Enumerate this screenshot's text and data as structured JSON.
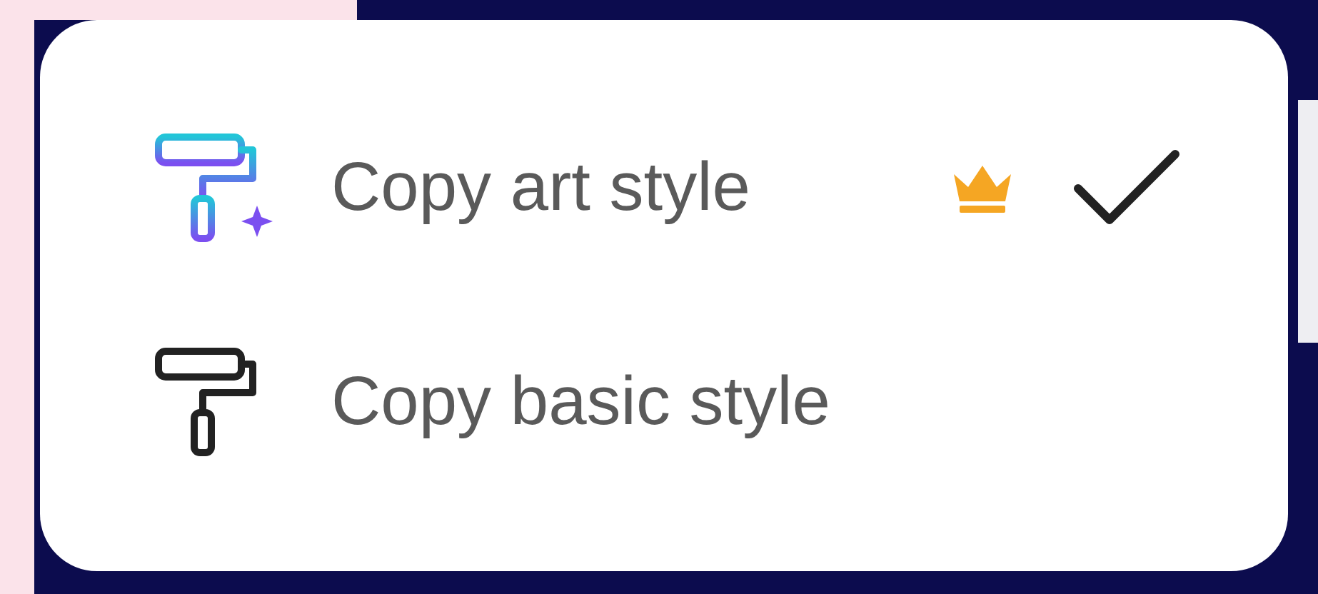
{
  "menu": {
    "items": [
      {
        "kind": "art",
        "label": "Copy art style",
        "premium": true,
        "selected": true
      },
      {
        "kind": "basic",
        "label": "Copy basic style",
        "premium": false,
        "selected": false
      }
    ]
  }
}
